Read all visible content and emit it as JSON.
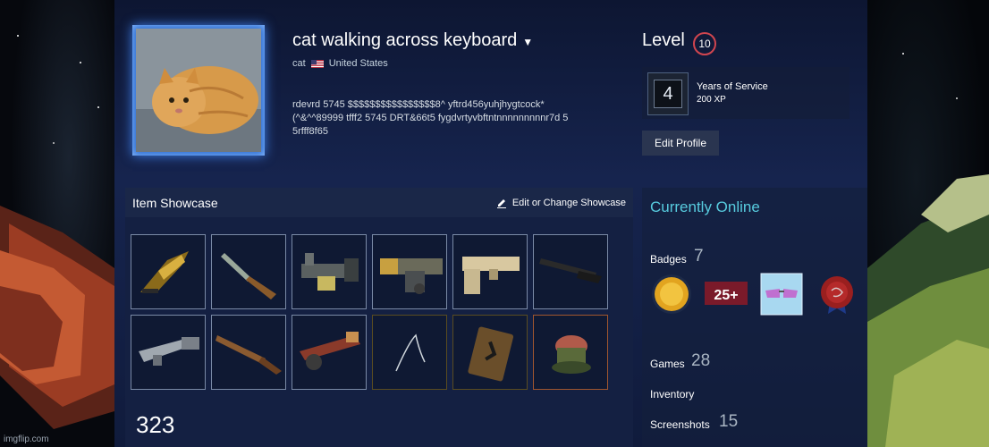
{
  "profile": {
    "persona_name": "cat walking across keyboard",
    "real_name": "cat",
    "country": "United States",
    "summary": "rdevrd 5745 $$$$$$$$$$$$$$$$8^ yftrd456yuhjhygtcock*\n(^&^^89999 tfff2 5745 DRT&66t5 fygdvrtyvbftntnnnnnnnnnr7d 5\n5rfff8f65",
    "level_label": "Level",
    "level": "10",
    "years_of_service_title": "Years of Service",
    "years_of_service_xp": "200 XP",
    "years_of_service_number": "4",
    "edit_profile_label": "Edit Profile",
    "status": "Currently Online"
  },
  "showcase": {
    "title": "Item Showcase",
    "edit_label": "Edit or Change Showcase",
    "count": "323",
    "items": [
      {
        "name": "item-1-crossbow",
        "quality": "normal"
      },
      {
        "name": "item-2-knife",
        "quality": "normal"
      },
      {
        "name": "item-3-launcher",
        "quality": "normal"
      },
      {
        "name": "item-4-rocket-launcher",
        "quality": "normal"
      },
      {
        "name": "item-5-shotgun-boxy",
        "quality": "normal"
      },
      {
        "name": "item-6-shotgun-long",
        "quality": "normal"
      },
      {
        "name": "item-7-scattergun",
        "quality": "normal"
      },
      {
        "name": "item-8-shotgun-wood",
        "quality": "normal"
      },
      {
        "name": "item-9-rocket-launcher-red",
        "quality": "normal"
      },
      {
        "name": "item-10-wire",
        "quality": "unique"
      },
      {
        "name": "item-11-card",
        "quality": "unique"
      },
      {
        "name": "item-12-hat",
        "quality": "strange"
      }
    ]
  },
  "sidebar": {
    "badges_label": "Badges",
    "badges_count": "7",
    "badges": [
      "gold-coin-badge-icon",
      "25-plus-badge-icon",
      "sunglasses-badge-icon",
      "red-seal-badge-icon"
    ],
    "games_label": "Games",
    "games_count": "28",
    "inventory_label": "Inventory",
    "screenshots_label": "Screenshots",
    "screenshots_count": "15"
  },
  "watermark": "imgflip.com",
  "colors": {
    "accent": "#57cbde",
    "level_ring": "#d0454f",
    "panel": "#142042"
  }
}
